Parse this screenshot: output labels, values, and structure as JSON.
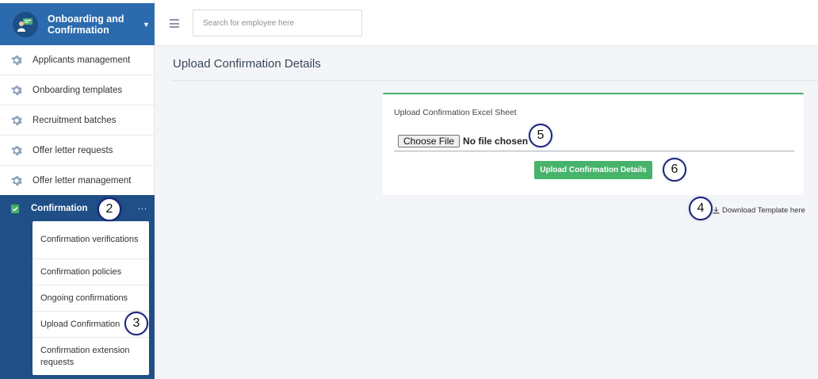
{
  "sidebar": {
    "module_title": "Onboarding and Confirmation",
    "items": [
      {
        "label": "Applicants management"
      },
      {
        "label": "Onboarding templates"
      },
      {
        "label": "Recruitment batches"
      },
      {
        "label": "Offer letter requests"
      },
      {
        "label": "Offer letter management"
      }
    ],
    "active": {
      "label": "Confirmation",
      "more": "...",
      "subitems": [
        {
          "label": "Confirmation verifications"
        },
        {
          "label": "Confirmation policies"
        },
        {
          "label": "Ongoing confirmations"
        },
        {
          "label": "Upload Confirmation"
        },
        {
          "label": "Confirmation extension requests"
        }
      ]
    }
  },
  "topbar": {
    "search_placeholder": "Search for employee here"
  },
  "main": {
    "page_title": "Upload Confirmation Details",
    "card": {
      "title": "Upload Confirmation Excel Sheet",
      "choose_file_label": "Choose File",
      "no_file_text": "No file chosen",
      "upload_button": "Upload Confirmation Details"
    },
    "download_link": "Download Template here"
  },
  "callouts": {
    "c2": "2",
    "c3": "3",
    "c4": "4",
    "c5": "5",
    "c6": "6"
  },
  "colors": {
    "sidebar_header": "#2b6aad",
    "sidebar_active": "#1f4f86",
    "accent_green": "#46b26a",
    "callout_border": "#1a237e"
  }
}
